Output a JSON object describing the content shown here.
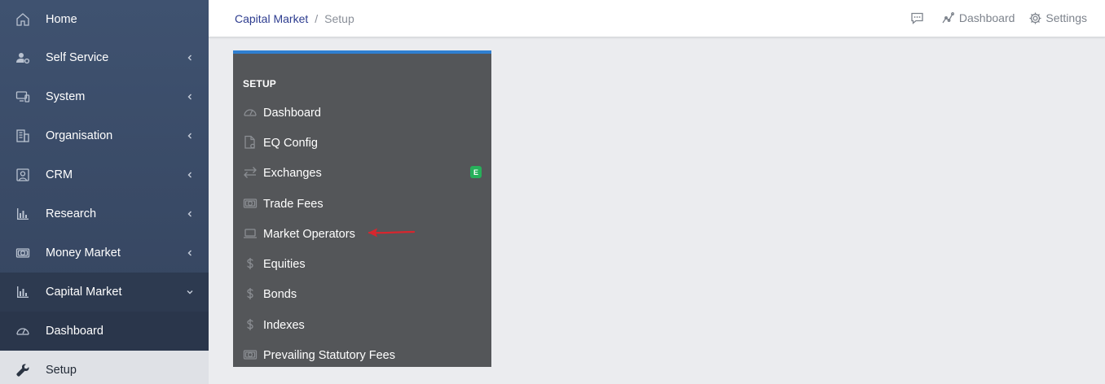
{
  "sidebar": {
    "items": [
      {
        "label": "Home",
        "icon": "home-icon"
      },
      {
        "label": "Self Service",
        "icon": "user-gear-icon"
      },
      {
        "label": "System",
        "icon": "devices-icon"
      },
      {
        "label": "Organisation",
        "icon": "building-icon"
      },
      {
        "label": "CRM",
        "icon": "contact-frame-icon"
      },
      {
        "label": "Research",
        "icon": "bar-chart-icon"
      },
      {
        "label": "Money Market",
        "icon": "money-icon"
      },
      {
        "label": "Capital Market",
        "icon": "bar-chart-icon"
      },
      {
        "label": "Dashboard",
        "icon": "gauge-icon"
      },
      {
        "label": "Setup",
        "icon": "wrench-icon"
      }
    ]
  },
  "topbar": {
    "breadcrumb": {
      "parent": "Capital Market",
      "separator": "/",
      "current": "Setup"
    },
    "actions": {
      "dashboard": "Dashboard",
      "settings": "Settings"
    }
  },
  "panel": {
    "title": "SETUP",
    "items": [
      {
        "label": "Dashboard",
        "icon": "gauge-icon"
      },
      {
        "label": "EQ Config",
        "icon": "file-gear-icon"
      },
      {
        "label": "Exchanges",
        "icon": "exchange-arrows-icon",
        "badge": "E"
      },
      {
        "label": "Trade Fees",
        "icon": "money-icon"
      },
      {
        "label": "Market Operators",
        "icon": "laptop-icon"
      },
      {
        "label": "Equities",
        "icon": "dollar-icon"
      },
      {
        "label": "Bonds",
        "icon": "dollar-icon"
      },
      {
        "label": "Indexes",
        "icon": "dollar-icon"
      },
      {
        "label": "Prevailing Statutory Fees",
        "icon": "money-icon"
      }
    ]
  },
  "colors": {
    "accent": "#2f7fd1",
    "badge": "#26b05a",
    "annotation_arrow": "#d7262e",
    "sidebar_bg": "#3f5270",
    "panel_bg": "#545659"
  }
}
